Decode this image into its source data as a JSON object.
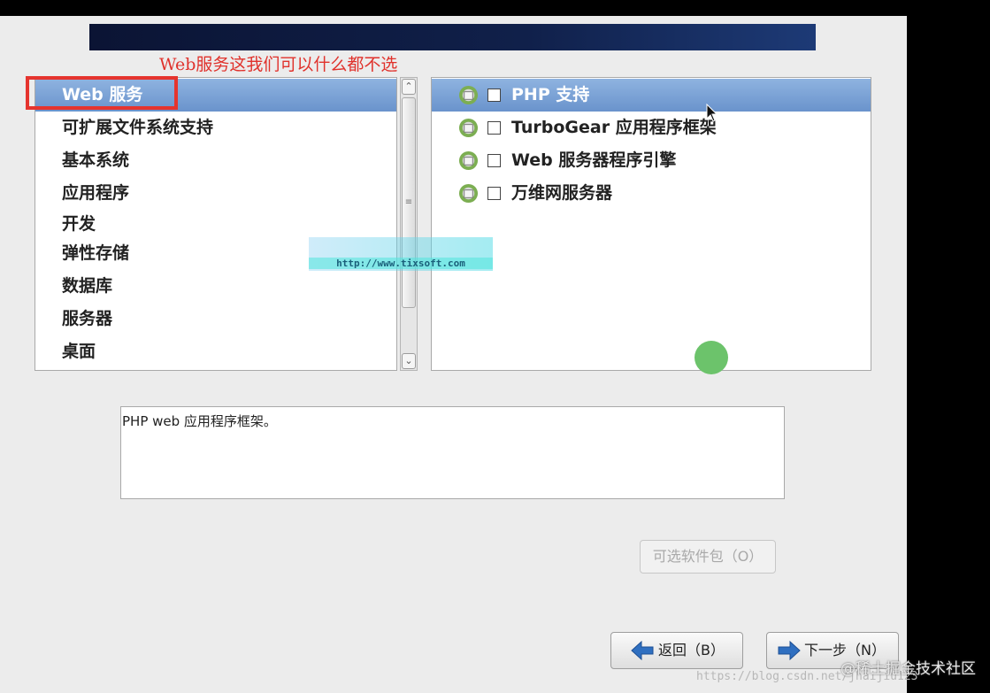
{
  "annotation": "Web服务这我们可以什么都不选",
  "categories": {
    "items": [
      {
        "label": "Web 服务",
        "selected": true
      },
      {
        "label": "可扩展文件系统支持"
      },
      {
        "label": "基本系统"
      },
      {
        "label": "应用程序"
      },
      {
        "label": "开发"
      },
      {
        "label": "弹性存储"
      },
      {
        "label": "数据库"
      },
      {
        "label": "服务器"
      },
      {
        "label": "桌面"
      }
    ]
  },
  "packages": {
    "items": [
      {
        "label": "PHP 支持",
        "checked": false,
        "selected": true
      },
      {
        "label": "TurboGear 应用程序框架",
        "checked": false
      },
      {
        "label": "Web 服务器程序引擎",
        "checked": false
      },
      {
        "label": "万维网服务器",
        "checked": false
      }
    ]
  },
  "description": "PHP web 应用程序框架。",
  "buttons": {
    "optional_packages": "可选软件包（O）",
    "back": "返回（B）",
    "next": "下一步（N）"
  },
  "watermarks": {
    "center_url": "http://www.tixsoft.com",
    "bottom_url": "https://blog.csdn.net/jhaijiu123",
    "community": "@稀土掘金技术社区"
  },
  "colors": {
    "selection": "#7aa1d6",
    "annotation": "#e0322c",
    "highlight_box": "#e5342e"
  }
}
